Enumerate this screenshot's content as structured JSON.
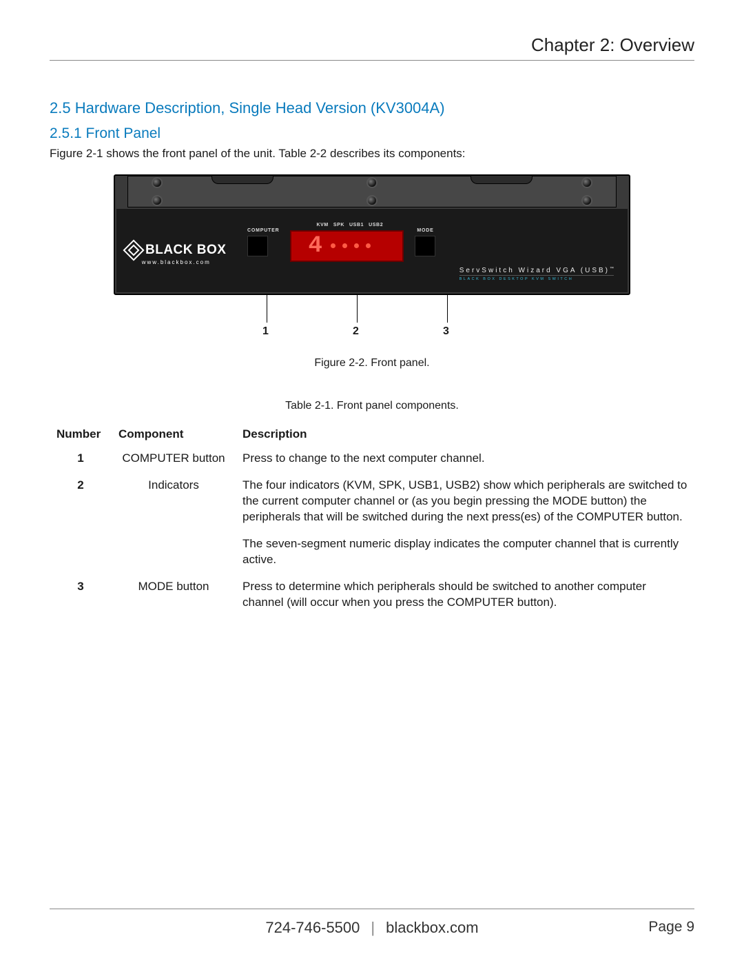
{
  "header": {
    "chapter": "Chapter 2: Overview"
  },
  "section": {
    "h2": "2.5 Hardware Description, Single Head Version (KV3004A)",
    "h3": "2.5.1 Front Panel",
    "intro": "Figure 2-1 shows the front panel of the unit. Table 2-2 describes its components:"
  },
  "device": {
    "brand_name": "BLACK BOX",
    "brand_url": "www.blackbox.com",
    "btn_computer_label": "COMPUTER",
    "btn_mode_label": "MODE",
    "display_labels": [
      "KVM",
      "SPK",
      "USB1",
      "USB2"
    ],
    "display_digit": "4",
    "product_line1": "ServSwitch Wizard VGA (USB)",
    "product_line2": "BLACK BOX DESKTOP KVM SWITCH"
  },
  "callouts": {
    "c1": "1",
    "c2": "2",
    "c3": "3"
  },
  "figure_caption": "Figure 2-2. Front panel.",
  "table_caption": "Table 2-1. Front panel components.",
  "table": {
    "headers": {
      "number": "Number",
      "component": "Component",
      "description": "Description"
    },
    "rows": [
      {
        "number": "1",
        "component": "COMPUTER button",
        "description": "Press to change to the next computer channel."
      },
      {
        "number": "2",
        "component": "Indicators",
        "description": "The four indicators (KVM, SPK, USB1, USB2) show which peripherals are switched to the current computer channel or (as you begin pressing the MODE button) the peripherals that will be switched during the next press(es) of the COMPUTER button."
      },
      {
        "number": "",
        "component": "",
        "description": "The seven-segment numeric display indicates the computer channel that is currently active."
      },
      {
        "number": "3",
        "component": "MODE button",
        "description": "Press to determine which peripherals should be switched to another computer channel (will occur when you press the COMPUTER button)."
      }
    ]
  },
  "footer": {
    "phone": "724-746-5500",
    "site": "blackbox.com",
    "page_label": "Page",
    "page_number": "9"
  }
}
